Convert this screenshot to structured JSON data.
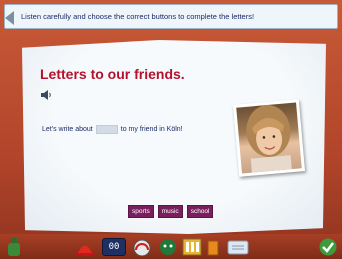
{
  "instruction": {
    "text": "Listen carefully and choose the correct buttons to complete the letters!"
  },
  "card": {
    "title": "Letters to our friends.",
    "sentence_before": "Let's write about",
    "sentence_after": "to my friend in Köln!"
  },
  "word_options": [
    "sports",
    "music",
    "school"
  ],
  "toolbar": {
    "counter_value": "00"
  },
  "colors": {
    "title": "#b3122e",
    "word_button": "#7a1f5e",
    "frame": "#b5462a",
    "text": "#1d2b63"
  }
}
